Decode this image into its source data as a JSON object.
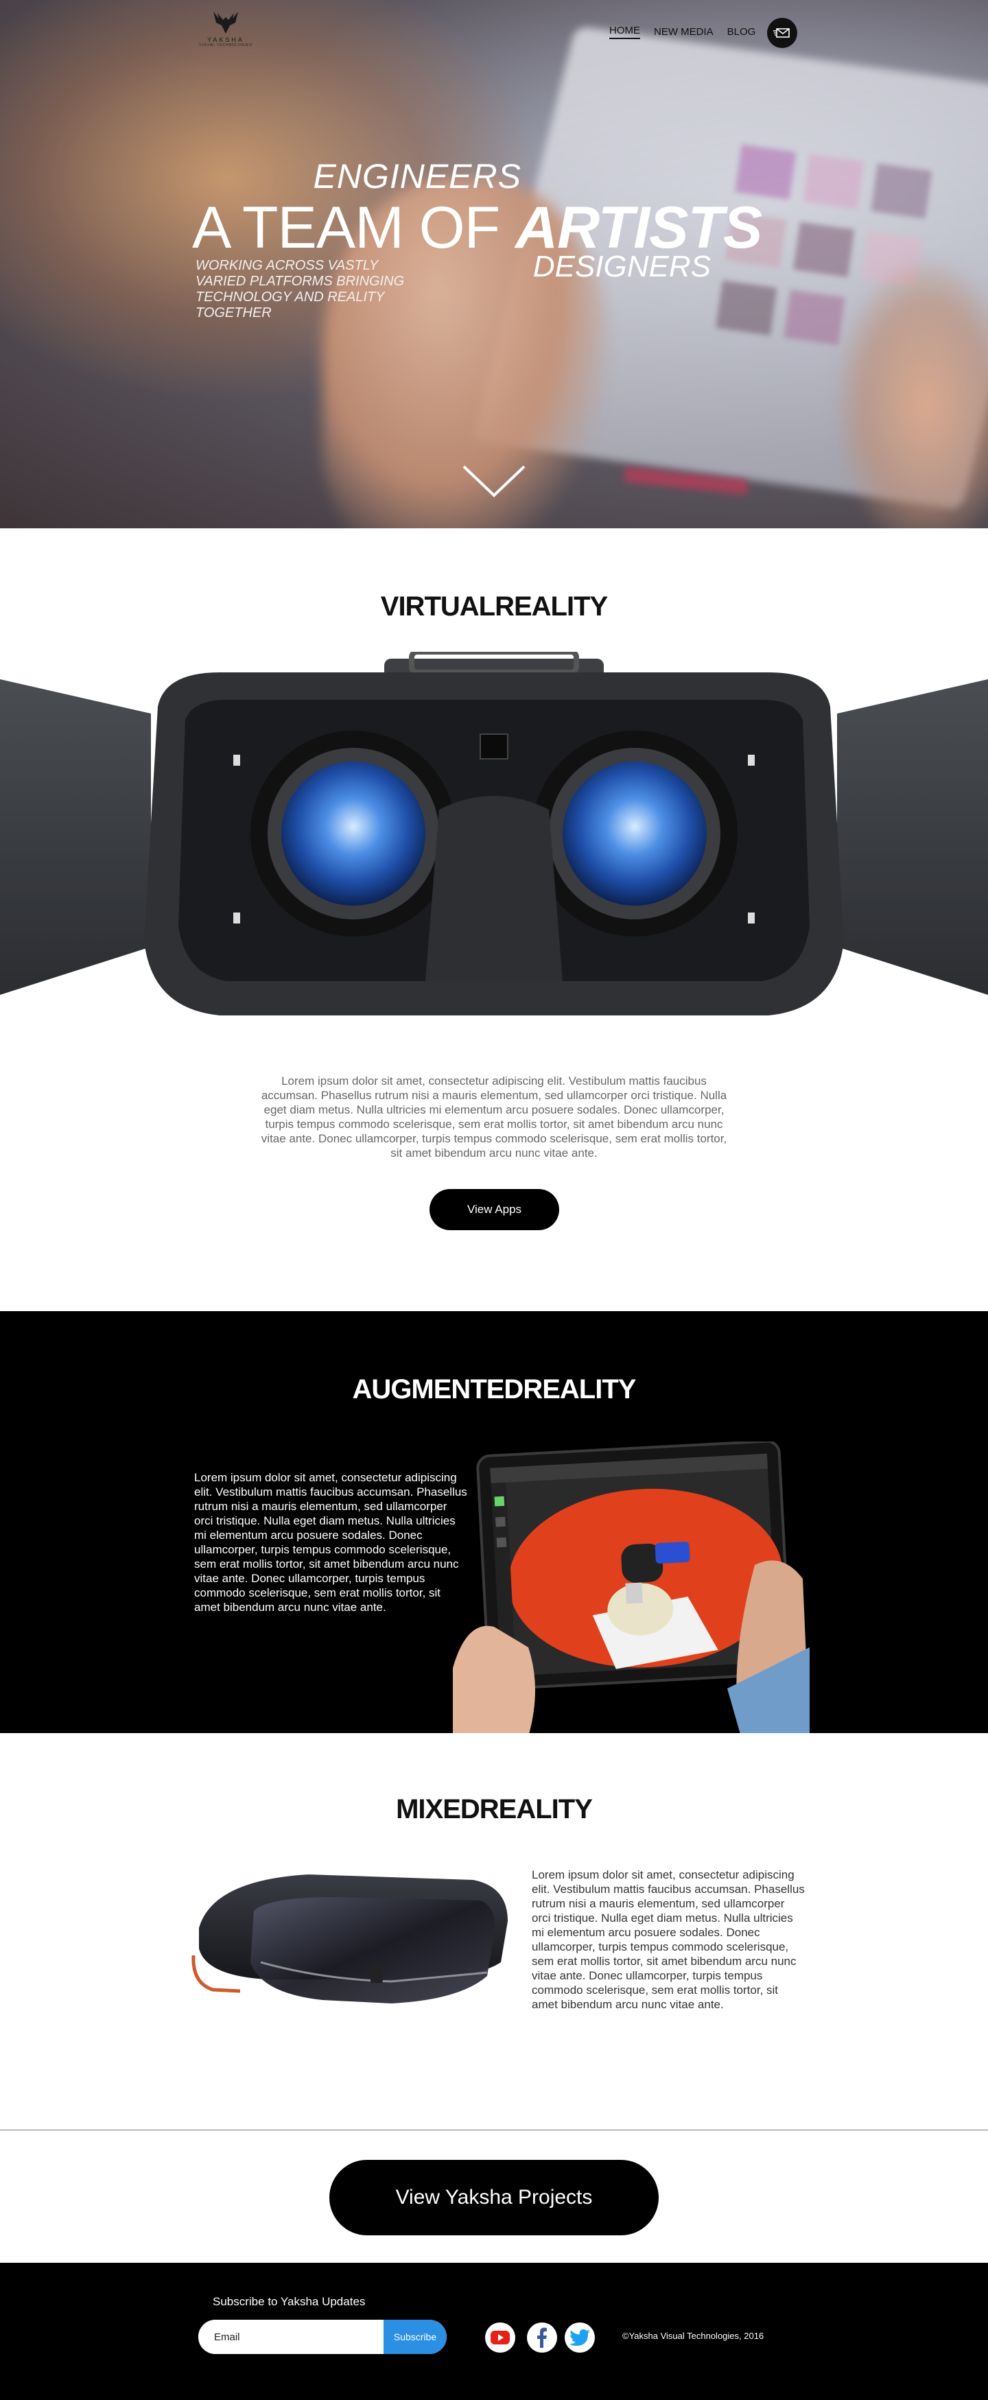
{
  "brand": {
    "name": "YAKSHA",
    "tagline": "VISUAL TECHNOLOGIES"
  },
  "nav": {
    "items": [
      "HOME",
      "NEW MEDIA",
      "BLOG"
    ],
    "active": "HOME"
  },
  "hero": {
    "engineers": "ENGINEERS",
    "main_prefix": "A TEAM OF ",
    "main_bold": "ARTISTS",
    "designers": "DESIGNERS",
    "subtitle": "WORKING ACROSS VASTLY VARIED PLATFORMS BRINGING TECHNOLOGY AND REALITY TOGETHER"
  },
  "vr": {
    "title_light": "VIRTUAL",
    "title_bold": "REALITY",
    "body": "Lorem ipsum dolor sit amet, consectetur adipiscing elit. Vestibulum mattis faucibus accumsan. Phasellus rutrum nisi a mauris elementum, sed ullamcorper orci tristique. Nulla eget diam metus. Nulla ultricies mi elementum arcu posuere sodales. Donec ullamcorper, turpis tempus commodo scelerisque, sem erat mollis tortor, sit amet bibendum arcu nunc vitae ante. Donec ullamcorper, turpis tempus commodo scelerisque, sem erat mollis tortor, sit amet bibendum arcu nunc vitae ante.",
    "button": "View Apps"
  },
  "ar": {
    "title_light": "AUGMENTED",
    "title_bold": "REALITY",
    "body": "Lorem ipsum dolor sit amet, consectetur adipiscing elit. Vestibulum mattis faucibus accumsan. Phasellus rutrum nisi a mauris elementum, sed ullamcorper orci tristique. Nulla eget diam metus. Nulla ultricies mi elementum arcu posuere sodales. Donec ullamcorper, turpis tempus commodo scelerisque, sem erat mollis tortor, sit amet bibendum arcu nunc vitae ante. Donec ullamcorper, turpis tempus commodo scelerisque, sem erat mollis tortor, sit amet bibendum arcu nunc vitae ante."
  },
  "mr": {
    "title_light": "MIXED",
    "title_bold": "REALITY",
    "body": "Lorem ipsum dolor sit amet, consectetur adipiscing elit. Vestibulum mattis faucibus accumsan. Phasellus rutrum nisi a mauris elementum, sed ullamcorper orci tristique. Nulla eget diam metus. Nulla ultricies mi elementum arcu posuere sodales. Donec ullamcorper, turpis tempus commodo scelerisque, sem erat mollis tortor, sit amet bibendum arcu nunc vitae ante. Donec ullamcorper, turpis tempus commodo scelerisque, sem erat mollis tortor, sit amet bibendum arcu nunc vitae ante."
  },
  "projects_button": "View Yaksha Projects",
  "footer": {
    "subscribe_label": "Subscribe to Yaksha Updates",
    "email_placeholder": "Email",
    "subscribe_button": "Subscribe",
    "social": [
      "youtube-icon",
      "facebook-icon",
      "twitter-icon"
    ],
    "copyright": "©Yaksha Visual Technologies, 2016"
  },
  "colors": {
    "subscribe_button": "#2b8fe3",
    "youtube": "#e62117",
    "facebook": "#3b5998",
    "twitter": "#1da1f2"
  }
}
